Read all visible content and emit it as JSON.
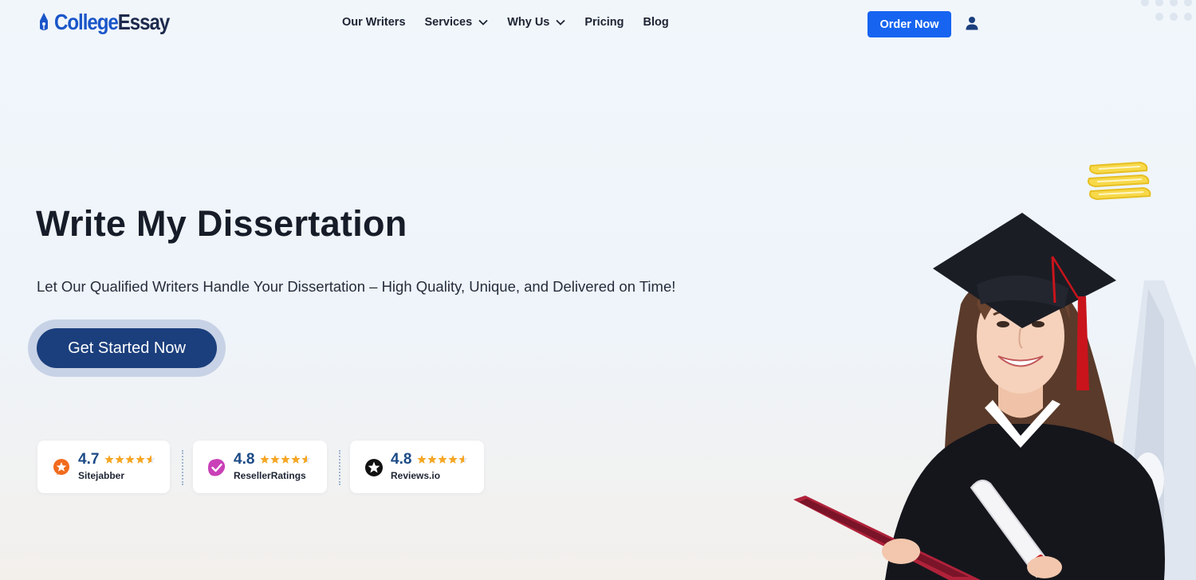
{
  "brand": {
    "part1": "College",
    "part2": "Essay"
  },
  "nav": {
    "items": [
      {
        "label": "Our Writers",
        "dropdown": false
      },
      {
        "label": "Services",
        "dropdown": true
      },
      {
        "label": "Why Us",
        "dropdown": true
      },
      {
        "label": "Pricing",
        "dropdown": false
      },
      {
        "label": "Blog",
        "dropdown": false
      }
    ],
    "order_label": "Order Now"
  },
  "hero": {
    "title": "Write My Dissertation",
    "subtitle": "Let Our Qualified Writers Handle Your Dissertation – High Quality, Unique, and Delivered on Time!",
    "cta_label": "Get Started Now"
  },
  "ratings": [
    {
      "score": "4.7",
      "site": "Sitejabber",
      "icon": "sitejabber-icon",
      "color": "#f26b1d"
    },
    {
      "score": "4.8",
      "site": "ResellerRatings",
      "icon": "resellerratings-icon",
      "color": "#c940b8"
    },
    {
      "score": "4.8",
      "site": "Reviews.io",
      "icon": "reviewsio-icon",
      "color": "#111111"
    }
  ],
  "colors": {
    "accent": "#1664f0",
    "primary_dark": "#1b3f7d",
    "star": "#f5a623"
  }
}
